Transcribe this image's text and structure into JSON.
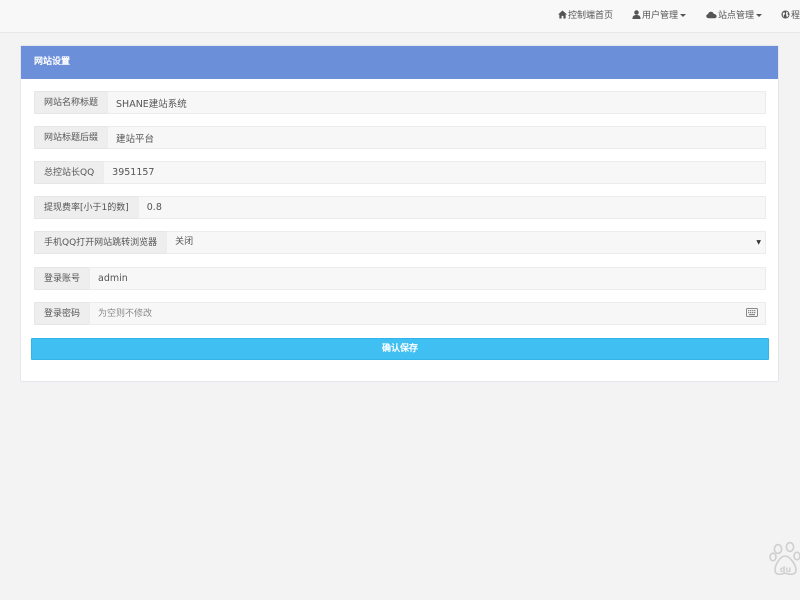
{
  "navbar": {
    "home_label": "控制端首页",
    "users_label": "用户管理",
    "sites_label": "站点管理",
    "more_label": "程"
  },
  "panel": {
    "title": "网站设置"
  },
  "form": {
    "site_name": {
      "label": "网站名称标题",
      "value": "SHANE建站系统"
    },
    "title_suffix": {
      "label": "网站标题后缀",
      "value": "建站平台"
    },
    "admin_qq": {
      "label": "总控站长QQ",
      "value": "3951157"
    },
    "withdraw_rate": {
      "label": "提现费率[小于1的数]",
      "value": "0.8"
    },
    "qq_browser_redirect": {
      "label": "手机QQ打开网站跳转浏览器",
      "value": "关闭"
    },
    "login_account": {
      "label": "登录账号",
      "value": "admin"
    },
    "login_password": {
      "label": "登录密码",
      "value": "",
      "placeholder": "为空则不修改"
    },
    "save_label": "确认保存"
  },
  "icons": {
    "home": "home-icon",
    "user": "user-icon",
    "cloud": "cloud-icon",
    "globe": "globe-icon",
    "keyboard": "keyboard-icon",
    "baidu": "baidu-paw-icon"
  },
  "colors": {
    "panel_heading": "#6c8fd9",
    "save_button": "#3fbff2"
  }
}
